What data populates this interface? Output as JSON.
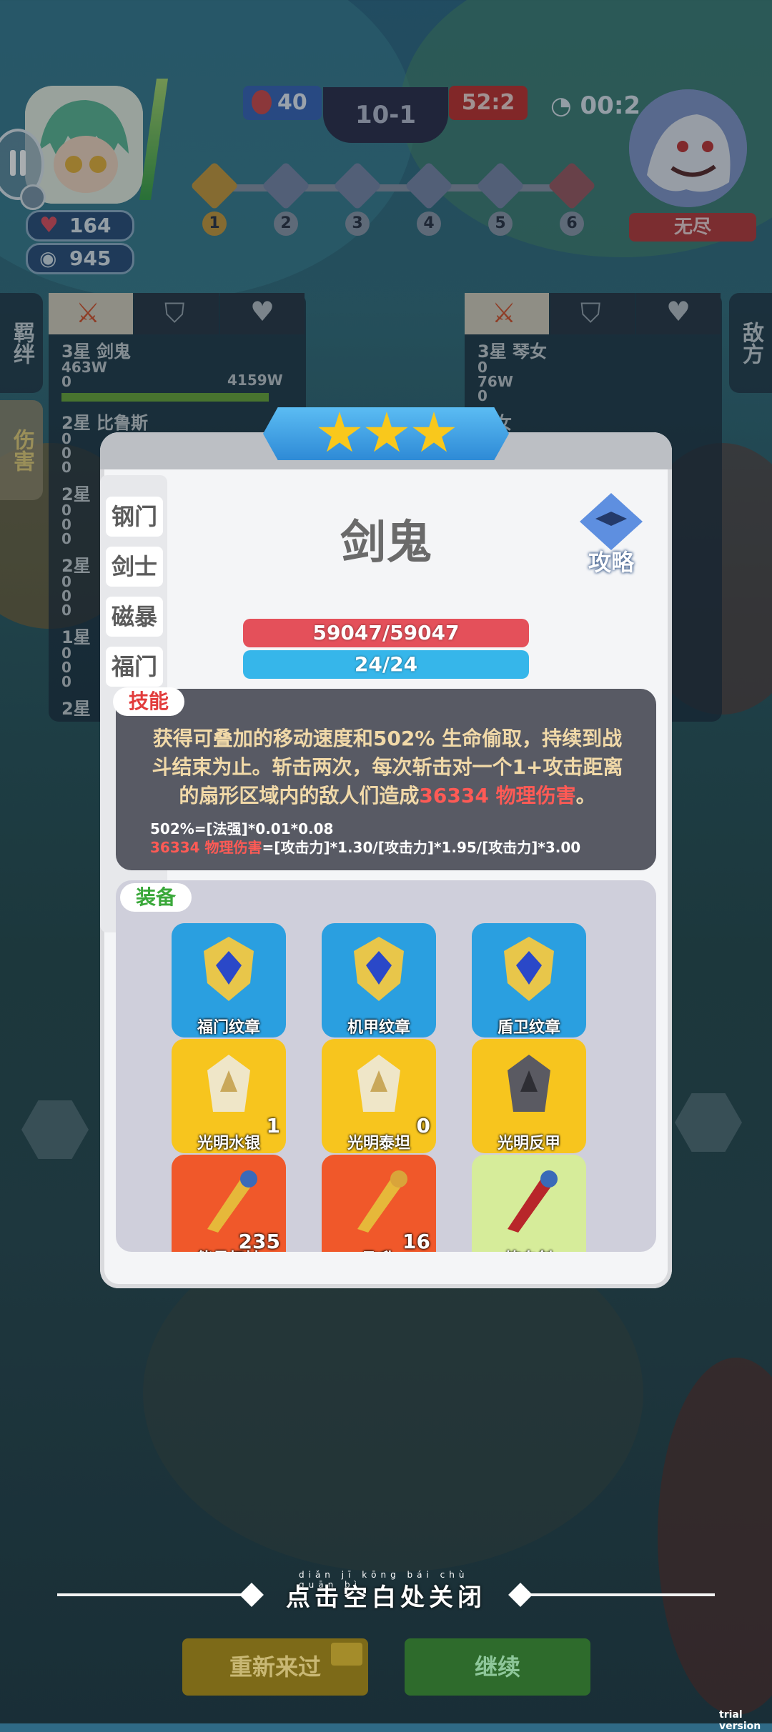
{
  "hud": {
    "hp": "164",
    "coins": "945",
    "blue_score": "40",
    "stage": "10-1",
    "red_score": "52:2",
    "timer": "00:2",
    "mode_badge": "无尽",
    "waves": [
      "1",
      "2",
      "3",
      "4",
      "5",
      "6"
    ]
  },
  "left_side": {
    "tab_bond": "羁绊",
    "tab_damage": "伤害",
    "rows": [
      {
        "name": "3星 剑鬼",
        "line1": "463W",
        "line2": "0",
        "line3": "4159W"
      },
      {
        "name": "2星 比鲁斯",
        "line1": "0",
        "line2": "0",
        "line3": "0"
      },
      {
        "name": "2星",
        "line1": "0",
        "line2": "0",
        "line3": "0"
      },
      {
        "name": "2星",
        "line1": "0",
        "line2": "0",
        "line3": "0"
      },
      {
        "name": "1星",
        "line1": "0",
        "line2": "0",
        "line3": "0"
      },
      {
        "name": "2星"
      }
    ]
  },
  "right_side": {
    "tab_enemy": "敌方",
    "rows": [
      {
        "name": "3星 琴女",
        "line1": "0",
        "line2": "76W",
        "line3": "0"
      },
      {
        "name": "琴女"
      }
    ]
  },
  "dialog": {
    "stars": 3,
    "hero_name": "剑鬼",
    "guide_label": "攻略",
    "traits": [
      "钢门",
      "剑士",
      "磁暴",
      "福门"
    ],
    "hp_bar": "59047/59047",
    "mp_bar": "24/24",
    "skill_tag": "技能",
    "skill_text_1": "获得可叠加的移动速度和502% 生命偷取，持续到战斗结束为止。斩击两次，每次斩击对一个1+攻击距离的扇形区域内的敌人们造成",
    "skill_damage": "36334 物理伤害",
    "skill_text_end": "。",
    "formula_1": "502%=[法强]*0.01*0.08",
    "formula_2_red": "36334 物理伤害",
    "formula_2_rest": "=[攻击力]*1.30/[攻击力]*1.95/[攻击力]*3.00",
    "equip_tag": "装备",
    "equipment": [
      {
        "name": "福门纹章",
        "count": "",
        "bg": "#2a9fe0"
      },
      {
        "name": "机甲纹章",
        "count": "",
        "bg": "#2a9fe0"
      },
      {
        "name": "盾卫纹章",
        "count": "",
        "bg": "#2a9fe0"
      },
      {
        "name": "光明水银",
        "count": "1",
        "bg": "#f7c51e"
      },
      {
        "name": "光明泰坦",
        "count": "0",
        "bg": "#f7c51e"
      },
      {
        "name": "光明反甲",
        "count": "",
        "bg": "#f7c51e"
      },
      {
        "name": "能量权杖",
        "count": "235",
        "bg": "#f0582a"
      },
      {
        "name": "飞升",
        "count": "16",
        "bg": "#f0582a"
      },
      {
        "name": "饮血剑",
        "count": "",
        "bg": "#d6ec9a"
      }
    ]
  },
  "footer": {
    "close_pinyin": "diǎn jī kōng bái chù guān bì",
    "close_text": "点击空白处关闭",
    "retry_label": "重新来过",
    "continue_label": "继续",
    "trial": "trial version"
  },
  "colors": {
    "hp_red": "#e4505a",
    "mp_blue": "#36b6ea",
    "damage_red": "#ff5a55",
    "skill_text": "#f1d9a8"
  }
}
